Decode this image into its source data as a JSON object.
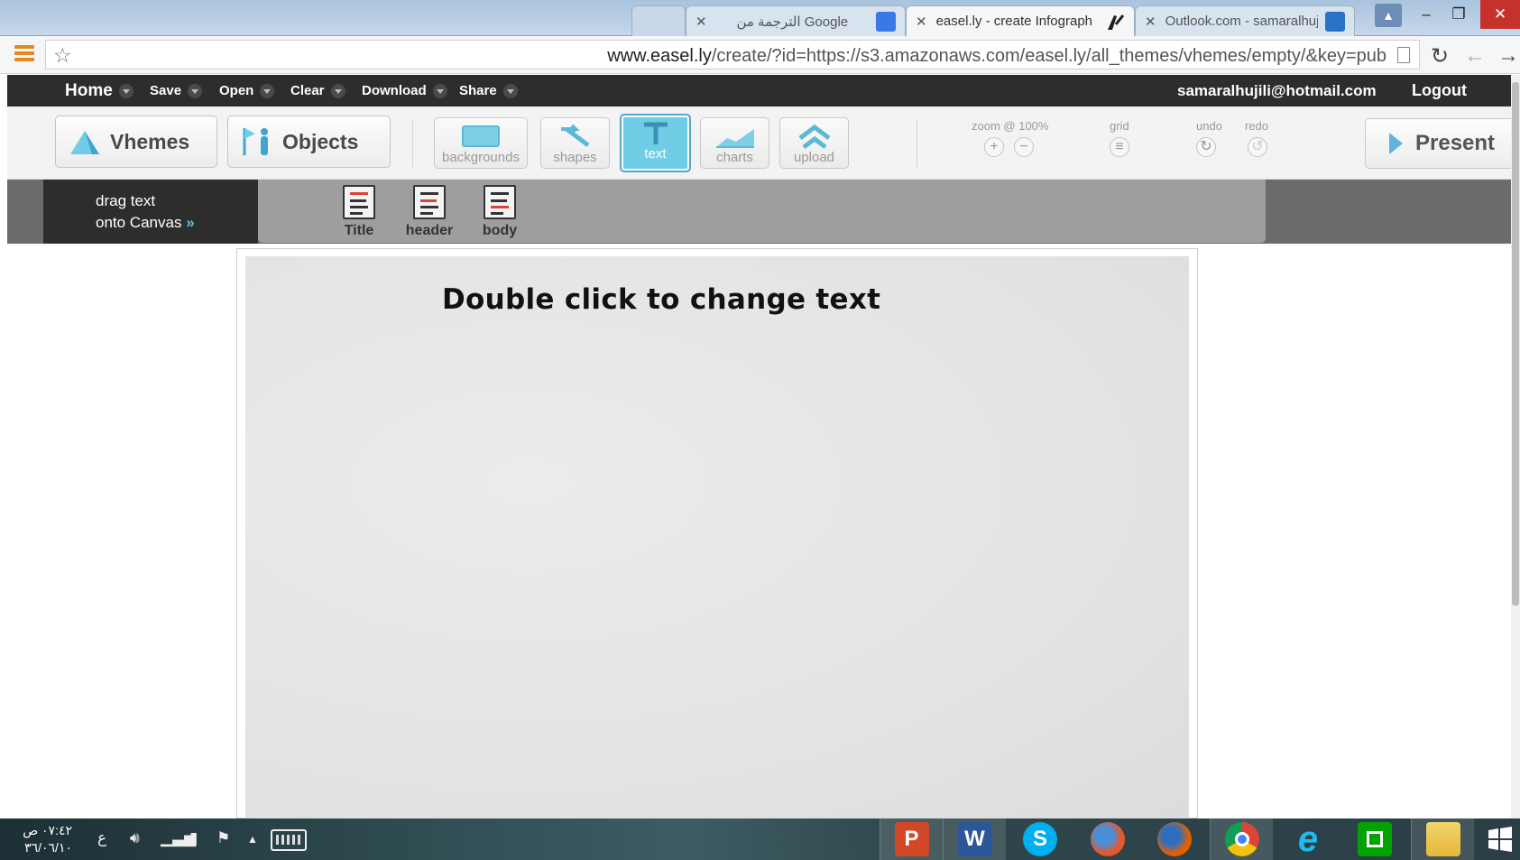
{
  "browser": {
    "tabs": [
      {
        "label": "",
        "kind": "new-tab"
      },
      {
        "label": "الترجمة من Google",
        "favicon": "google-translate-icon",
        "color": "#3b78e7"
      },
      {
        "label": "easel.ly - create Infograph",
        "favicon": "easelly-icon",
        "color": "#1d1d1d",
        "active": true
      },
      {
        "label": "Outlook.com - samaralhuj",
        "favicon": "outlook-icon",
        "color": "#2a72c6"
      }
    ],
    "url_host": "www.easel.ly",
    "url_rest": "/create/?id=https://s3.amazonaws.com/easel.ly/all_themes/vhemes/empty/&key=pub",
    "window_controls": {
      "minimize": "–",
      "restore": "❐",
      "close": "✕"
    }
  },
  "easelly": {
    "nav": {
      "home": "Home",
      "save": "Save",
      "open": "Open",
      "clear": "Clear",
      "download": "Download",
      "share": "Share",
      "user_email": "samaralhujili@hotmail.com",
      "logout": "Logout"
    },
    "toolbar": {
      "vhemes": "Vhemes",
      "objects": "Objects",
      "tools": [
        "backgrounds",
        "shapes",
        "text",
        "charts",
        "upload"
      ],
      "active_tool": "text",
      "zoom_label": "zoom @ 100%",
      "grid_label": "grid",
      "undo_label": "undo",
      "redo_label": "redo",
      "present": "Present"
    },
    "drawer": {
      "hint_line1": "drag text",
      "hint_line2": "onto Canvas",
      "hint_arrow": "»",
      "items": [
        "Title",
        "header",
        "body"
      ]
    },
    "canvas": {
      "text": "Double click to change text"
    }
  },
  "taskbar": {
    "time": "٠٧:٤٢ ص",
    "date": "٣٦/٠٦/١٠",
    "lang": "ع",
    "apps": [
      {
        "name": "powerpoint-icon",
        "letter": "P",
        "color": "#d24726"
      },
      {
        "name": "word-icon",
        "letter": "W",
        "color": "#2b579a"
      },
      {
        "name": "skype-icon",
        "letter": "S",
        "color": "#00aff0"
      },
      {
        "name": "firefox-beta-icon",
        "letter": "",
        "color": "#e8562a"
      },
      {
        "name": "firefox-icon",
        "letter": "",
        "color": "#e66000"
      },
      {
        "name": "chrome-icon",
        "letter": "",
        "color": "#db4437"
      },
      {
        "name": "internet-explorer-icon",
        "letter": "e",
        "color": "#1ebbee"
      },
      {
        "name": "store-icon",
        "letter": "",
        "color": "#00a300"
      },
      {
        "name": "file-explorer-icon",
        "letter": "",
        "color": "#f3c94b"
      }
    ]
  }
}
